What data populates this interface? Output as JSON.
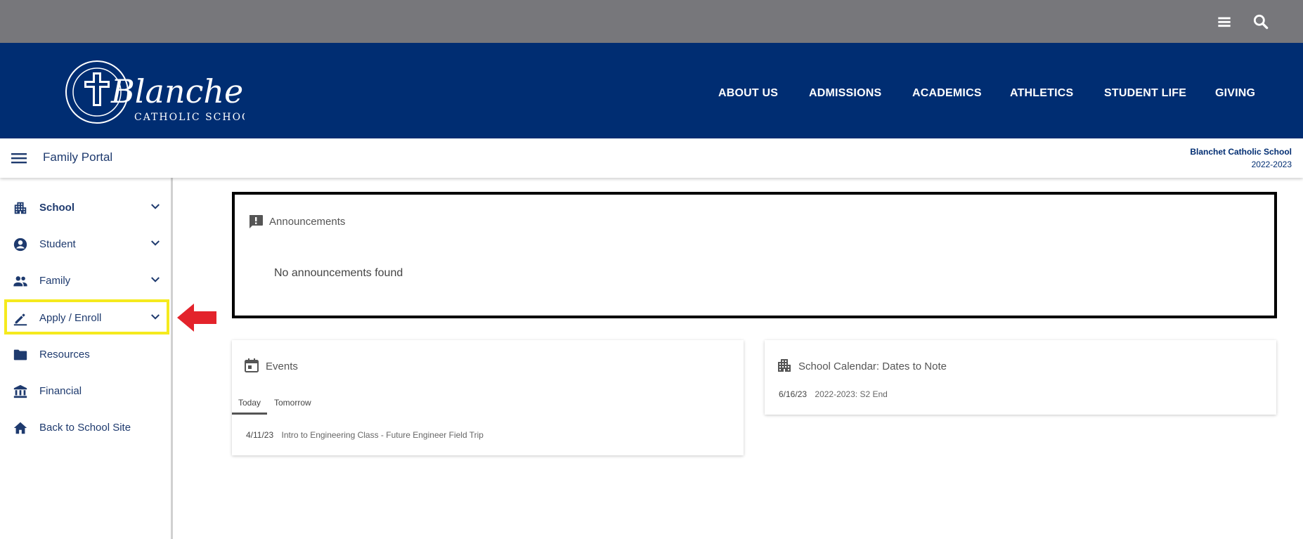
{
  "utility_bar": {
    "menu_icon": "hamburger-menu-icon",
    "search_icon": "search-icon"
  },
  "header": {
    "logo_alt": "Blanchet Catholic School",
    "logo_text": "Blanchet",
    "logo_subtext": "CATHOLIC SCHOOL",
    "nav": [
      {
        "label": "ABOUT US"
      },
      {
        "label": "ADMISSIONS"
      },
      {
        "label": "ACADEMICS"
      },
      {
        "label": "ATHLETICS"
      },
      {
        "label": "STUDENT LIFE"
      },
      {
        "label": "GIVING"
      }
    ],
    "brand_color": "#002d72"
  },
  "portal_bar": {
    "title": "Family Portal",
    "school_name": "Blanchet Catholic School",
    "school_year": "2022-2023"
  },
  "sidebar": {
    "items": [
      {
        "label": "School",
        "icon": "building-icon",
        "has_chevron": true,
        "bold": true
      },
      {
        "label": "Student",
        "icon": "account-circle-icon",
        "has_chevron": true
      },
      {
        "label": "Family",
        "icon": "people-icon",
        "has_chevron": true
      },
      {
        "label": "Apply / Enroll",
        "icon": "pencil-icon",
        "has_chevron": true,
        "highlighted": true
      },
      {
        "label": "Resources",
        "icon": "folder-icon",
        "has_chevron": false
      },
      {
        "label": "Financial",
        "icon": "bank-icon",
        "has_chevron": false
      },
      {
        "label": "Back to School Site",
        "icon": "home-icon",
        "has_chevron": false
      }
    ],
    "highlight_color": "#f5ea1e",
    "arrow_color": "#e3232b"
  },
  "announcements": {
    "title": "Announcements",
    "empty_message": "No announcements found"
  },
  "events": {
    "title": "Events",
    "tabs": [
      {
        "label": "Today",
        "active": true
      },
      {
        "label": "Tomorrow",
        "active": false
      }
    ],
    "items": [
      {
        "date": "4/11/23",
        "text": "Intro to Engineering Class - Future Engineer Field Trip"
      }
    ]
  },
  "calendar": {
    "title": "School Calendar: Dates to Note",
    "items": [
      {
        "date": "6/16/23",
        "text": "2022-2023: S2 End"
      }
    ]
  }
}
